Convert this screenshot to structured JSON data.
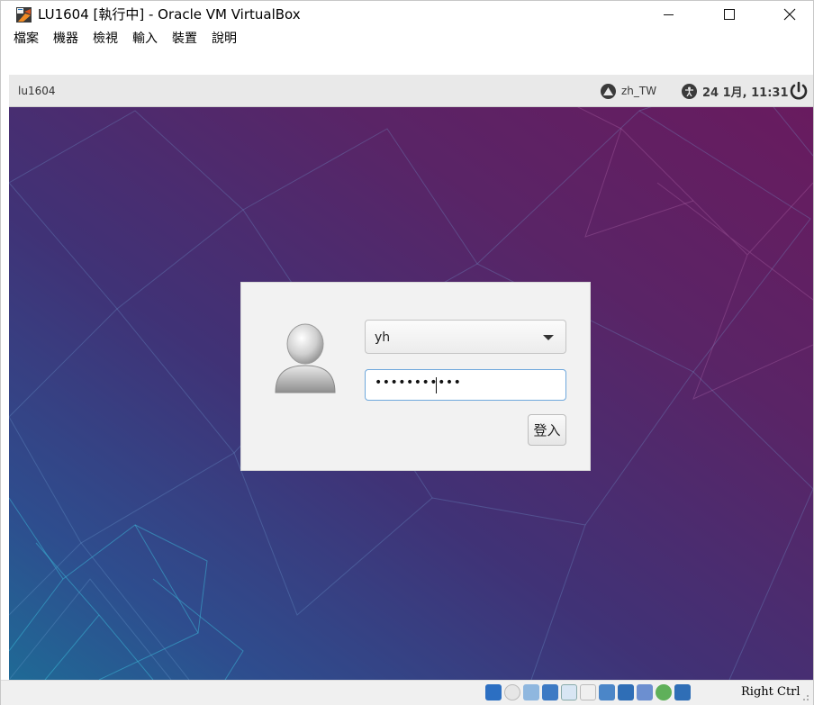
{
  "window": {
    "title": "LU1604 [執行中] - Oracle VM VirtualBox",
    "controls": {
      "minimize": "minimize",
      "maximize": "maximize",
      "close": "close"
    }
  },
  "menu": {
    "items": [
      "檔案",
      "機器",
      "檢視",
      "輸入",
      "裝置",
      "說明"
    ]
  },
  "guest_panel": {
    "hostname": "lu1604",
    "keyboard_layout": "zh_TW",
    "datetime": "24 1月, 11:31",
    "icons": [
      "network-icon",
      "accessibility-icon",
      "power-icon"
    ]
  },
  "login": {
    "username": "yh",
    "password_masked": "•••••••••••",
    "login_button": "登入"
  },
  "statusbar": {
    "host_key": "Right Ctrl",
    "icons": [
      "hard-disk-icon",
      "optical-drive-icon",
      "audio-icon",
      "network-icon",
      "usb-icon",
      "shared-folders-icon",
      "display-icon",
      "video-capture-icon",
      "virtualization-icon",
      "mouse-integration-icon",
      "host-key-icon"
    ]
  },
  "colors": {
    "bg_magenta": "#6a1a5e",
    "bg_blue": "#1f6a96",
    "panel": "#e9e9e9",
    "focus": "#6fa8dc"
  }
}
